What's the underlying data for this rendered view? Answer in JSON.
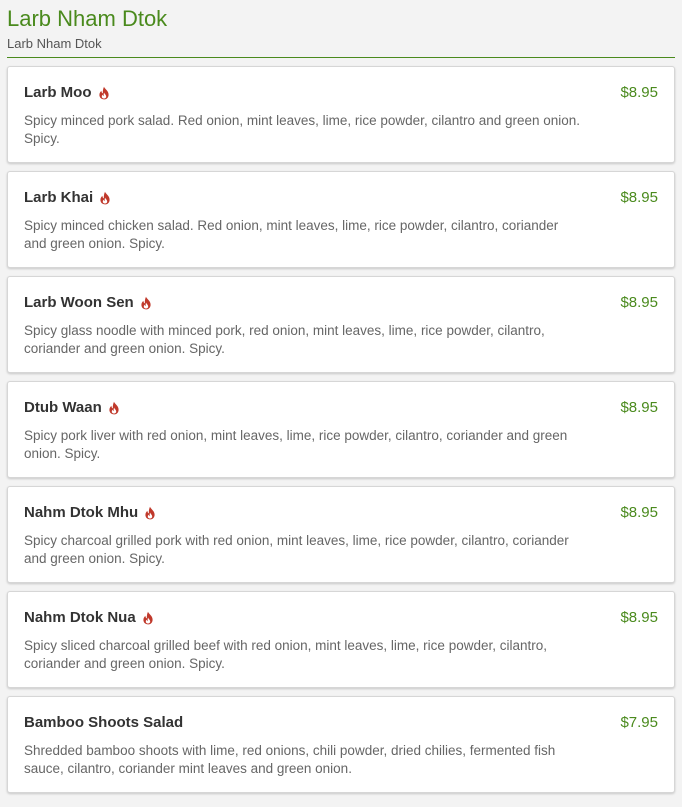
{
  "section": {
    "title": "Larb Nham Dtok",
    "subtitle": "Larb Nham Dtok"
  },
  "colors": {
    "accent": "#4a8a1d",
    "spicy": "#c0392b"
  },
  "items": [
    {
      "name": "Larb Moo",
      "price": "$8.95",
      "spicy": true,
      "description": "Spicy minced pork salad. Red onion, mint leaves, lime, rice powder, cilantro and green onion. Spicy."
    },
    {
      "name": "Larb Khai",
      "price": "$8.95",
      "spicy": true,
      "description": "Spicy minced chicken salad. Red onion, mint leaves, lime, rice powder, cilantro, coriander and green onion. Spicy."
    },
    {
      "name": "Larb Woon Sen",
      "price": "$8.95",
      "spicy": true,
      "description": "Spicy glass noodle with minced pork, red onion, mint leaves, lime, rice powder, cilantro, coriander and green onion. Spicy."
    },
    {
      "name": "Dtub Waan",
      "price": "$8.95",
      "spicy": true,
      "description": "Spicy pork liver with red onion, mint leaves, lime, rice powder, cilantro, coriander and green onion. Spicy."
    },
    {
      "name": "Nahm Dtok Mhu",
      "price": "$8.95",
      "spicy": true,
      "description": "Spicy charcoal grilled pork with red onion, mint leaves, lime, rice powder, cilantro, coriander and green onion. Spicy."
    },
    {
      "name": "Nahm Dtok Nua",
      "price": "$8.95",
      "spicy": true,
      "description": "Spicy sliced charcoal grilled beef with red onion, mint leaves, lime, rice powder, cilantro, coriander and green onion. Spicy."
    },
    {
      "name": "Bamboo Shoots Salad",
      "price": "$7.95",
      "spicy": false,
      "description": "Shredded bamboo shoots with lime, red onions, chili powder, dried chilies, fermented fish sauce, cilantro, coriander mint leaves and green onion."
    }
  ]
}
